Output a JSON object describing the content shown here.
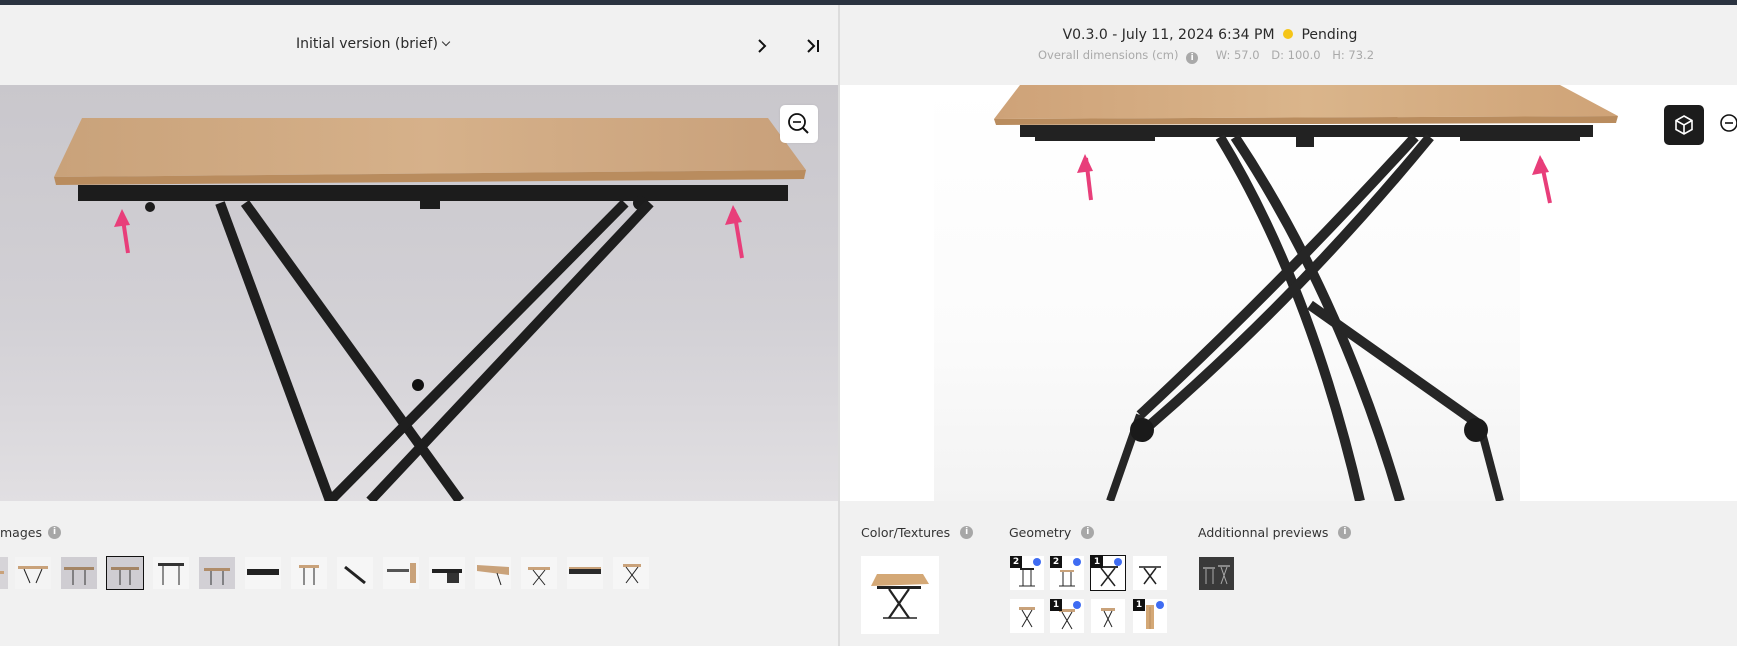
{
  "left_header": {
    "version_label": "Initial version (brief)"
  },
  "right_header": {
    "version_line": "V0.3.0 - July 11, 2024 6:34 PM",
    "status": "Pending",
    "status_color": "#f5c518",
    "dims_label": "Overall dimensions (cm)",
    "width": "W: 57.0",
    "depth": "D: 100.0",
    "height": "H: 73.2"
  },
  "bottom": {
    "images_label": "mages",
    "color_textures_label": "Color/Textures",
    "geometry_label": "Geometry",
    "additional_previews_label": "Additionnal previews",
    "geometry_badges": [
      "2",
      "2",
      "1",
      "",
      "",
      "1",
      "",
      "1"
    ]
  },
  "colors": {
    "accent_arrow": "#e83e7a",
    "wood": "#d4a876",
    "frame": "#1e1e1e",
    "badge_dot": "#3f6cf2"
  },
  "icons": {
    "zoom": "zoom-in-icon",
    "cube": "cube-3d-icon",
    "next": "chevron-right-icon",
    "last": "skip-to-last-icon",
    "info": "info-icon"
  }
}
